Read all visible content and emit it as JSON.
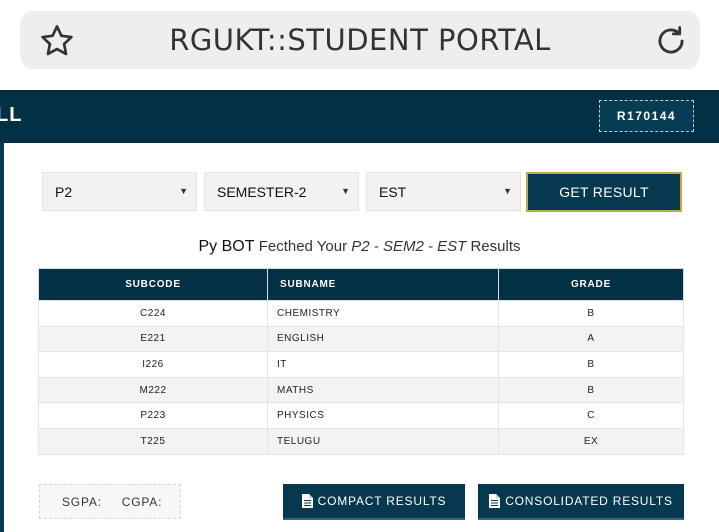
{
  "browser": {
    "title": "RGUKT::STUDENT PORTAL"
  },
  "header": {
    "left_text": "LL",
    "student_id": "R170144"
  },
  "filters": {
    "year": "P2",
    "semester": "SEMESTER-2",
    "exam": "EST",
    "get_result_label": "GET RESULT"
  },
  "message": {
    "bot": "Py BOT",
    "middle": "Fecthed Your",
    "query": "P2 - SEM2 - EST",
    "tail": "Results"
  },
  "table": {
    "headers": [
      "SUBCODE",
      "SUBNAME",
      "GRADE"
    ],
    "rows": [
      {
        "code": "C224",
        "name": "CHEMISTRY",
        "grade": "B"
      },
      {
        "code": "E221",
        "name": "ENGLISH",
        "grade": "A"
      },
      {
        "code": "I226",
        "name": "IT",
        "grade": "B"
      },
      {
        "code": "M222",
        "name": "MATHS",
        "grade": "B"
      },
      {
        "code": "P223",
        "name": "PHYSICS",
        "grade": "C"
      },
      {
        "code": "T225",
        "name": "TELUGU",
        "grade": "EX"
      }
    ]
  },
  "gpa": {
    "sgpa_label": "SGPA:",
    "cgpa_label": "CGPA:"
  },
  "actions": {
    "compact_label": "COMPACT RESULTS",
    "consolidated_label": "CONSOLIDATED RESULTS"
  },
  "colors": {
    "primary": "#043046",
    "accent_border": "#b9a94a"
  },
  "icons": [
    "star-icon",
    "reload-icon",
    "dropdown-arrow-icon",
    "document-icon"
  ]
}
